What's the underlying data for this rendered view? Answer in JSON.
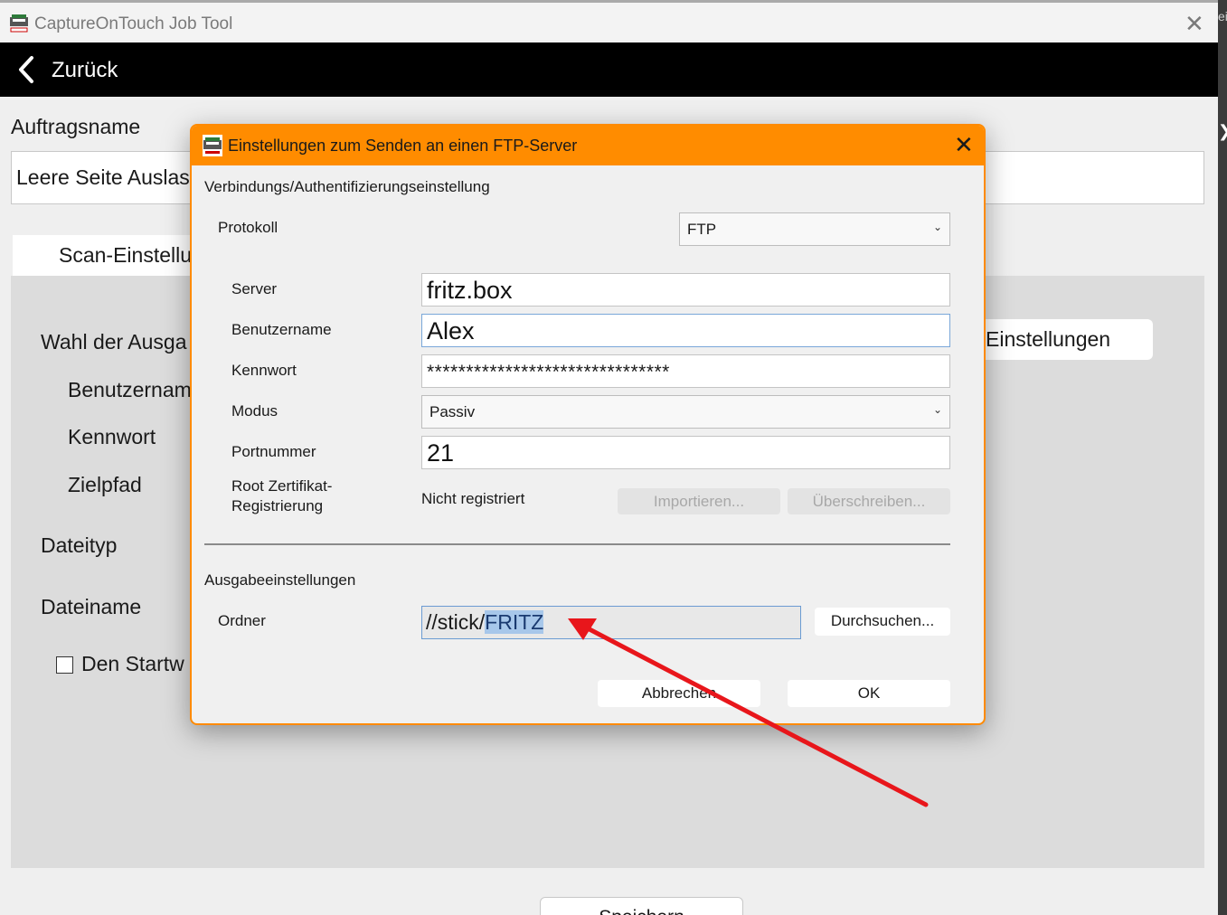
{
  "window": {
    "title": "CaptureOnTouch Job Tool",
    "close_glyph": "✕",
    "right_fragment": "ei",
    "right_chevron": "❯"
  },
  "nav": {
    "back_label": "Zurück"
  },
  "job": {
    "name_label": "Auftragsname",
    "name_value": "Leere Seite Auslas"
  },
  "tabs": {
    "scan_label": "Scan-Einstellu"
  },
  "panel": {
    "output_choice": "Wahl der Ausga",
    "username": "Benutzernam",
    "password": "Kennwort",
    "target_path": "Zielpfad",
    "file_type": "Dateityp",
    "file_name": "Dateiname",
    "checkbox_label": "Den Startw",
    "settings_button": "Einstellungen"
  },
  "footer": {
    "save_label": "Speichern"
  },
  "dialog": {
    "title": "Einstellungen zum Senden an einen FTP-Server",
    "close_glyph": "✕",
    "section_connection": "Verbindungs/Authentifizierungseinstellung",
    "protocol_label": "Protokoll",
    "protocol_value": "FTP",
    "server_label": "Server",
    "server_value": "fritz.box",
    "username_label": "Benutzername",
    "username_value": "Alex",
    "password_label": "Kennwort",
    "password_value": "*******************************",
    "mode_label": "Modus",
    "mode_value": "Passiv",
    "port_label": "Portnummer",
    "port_value": "21",
    "root_cert_label_1": "Root Zertifikat-",
    "root_cert_label_2": "Registrierung",
    "root_cert_status": "Nicht registriert",
    "import_button": "Importieren...",
    "overwrite_button": "Überschreiben...",
    "section_output": "Ausgabeeinstellungen",
    "folder_label": "Ordner",
    "folder_prefix": "//stick/",
    "folder_selected": "FRITZ",
    "browse_button": "Durchsuchen...",
    "cancel_button": "Abbrechen",
    "ok_button": "OK"
  },
  "colors": {
    "dialog_accent": "#ff8c00",
    "annotation_arrow": "#e8161b",
    "selection": "#a7c7ea"
  },
  "icons": {
    "app": "scanner-app-icon",
    "back": "chevron-left-icon",
    "dropdown": "chevron-down-icon"
  }
}
